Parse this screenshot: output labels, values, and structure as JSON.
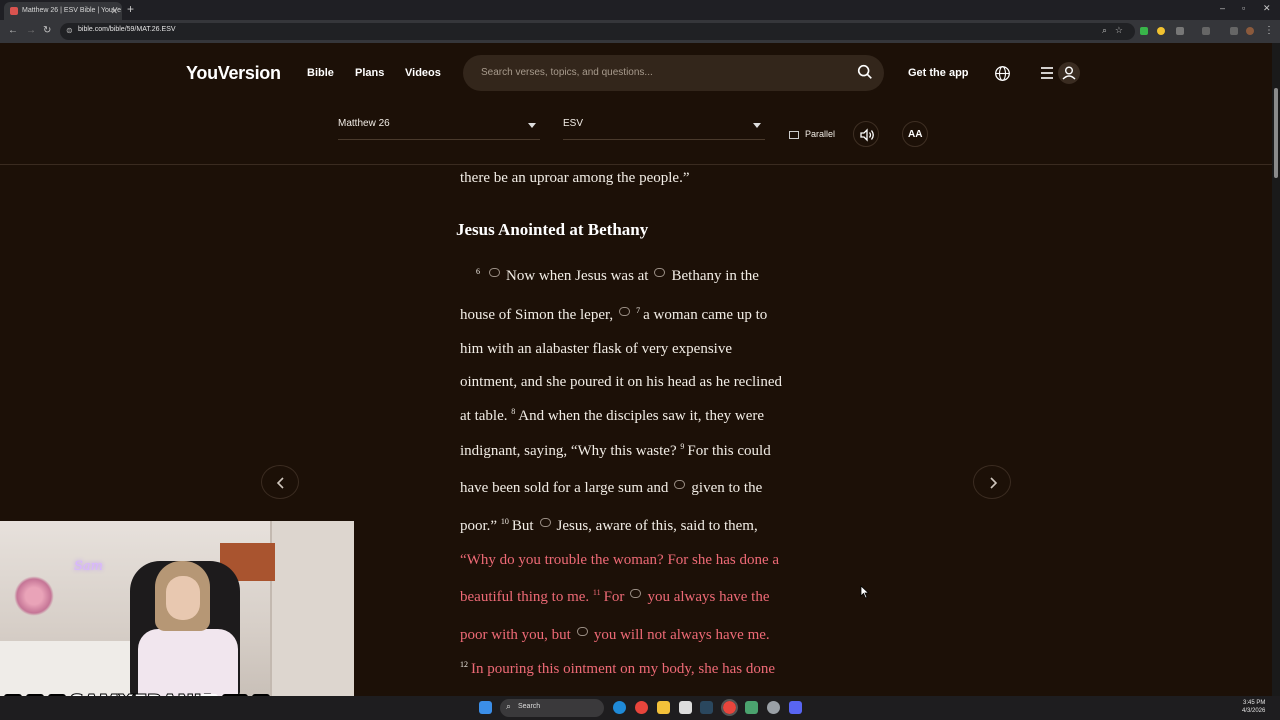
{
  "browser": {
    "tab_title": "Matthew 26 | ESV Bible | YouVe",
    "url": "bible.com/bible/59/MAT.26.ESV"
  },
  "header": {
    "logo": "YouVersion",
    "nav": [
      "Bible",
      "Plans",
      "Videos"
    ],
    "search_placeholder": "Search verses, topics, and questions...",
    "get_app": "Get the app"
  },
  "reader_bar": {
    "book_chapter": "Matthew 26",
    "version": "ESV",
    "parallel_label": "Parallel",
    "font_label": "AA"
  },
  "passage": {
    "line0": "there be an uproar among the people.”",
    "heading": "Jesus Anointed at Bethany",
    "v6": "6",
    "l1a": "Now when Jesus was at",
    "l1b": "Bethany in the",
    "l2a": "house of Simon the leper,",
    "v7": "7",
    "l2b": "a woman came up to",
    "l3": "him with an alabaster flask of very expensive",
    "l4": "ointment, and she poured it on his head as he reclined",
    "l5a": "at table.",
    "v8": "8",
    "l5b": "And when the disciples saw it, they were",
    "l6a": "indignant, saying, “Why this waste?",
    "v9": "9",
    "l6b": "For this could",
    "l7a": "have been sold for a large sum and",
    "l7b": "given to the",
    "l8a": "poor.”",
    "v10": "10",
    "l8b": "But",
    "l8c": "Jesus, aware of this, said to them,",
    "l9": "“Why do you trouble the woman? For she has done a",
    "l10a": "beautiful thing to me.",
    "v11": "11",
    "l10b": "For",
    "l10c": "you always have the",
    "l11a": "poor with you, but",
    "l11b": "you will not always have me.",
    "v12": "12",
    "l12": "In pouring this ointment on my body, she has done"
  },
  "stream_overlay": {
    "handle": "SAMXFRANK",
    "neon_sign": "Sam"
  },
  "taskbar": {
    "search_label": "Search",
    "time": "3:45 PM",
    "date": "4/3/2026"
  },
  "colors": {
    "background": "#1c1007",
    "words_of_christ": "#ee6a76",
    "search_bg": "#33261b"
  }
}
